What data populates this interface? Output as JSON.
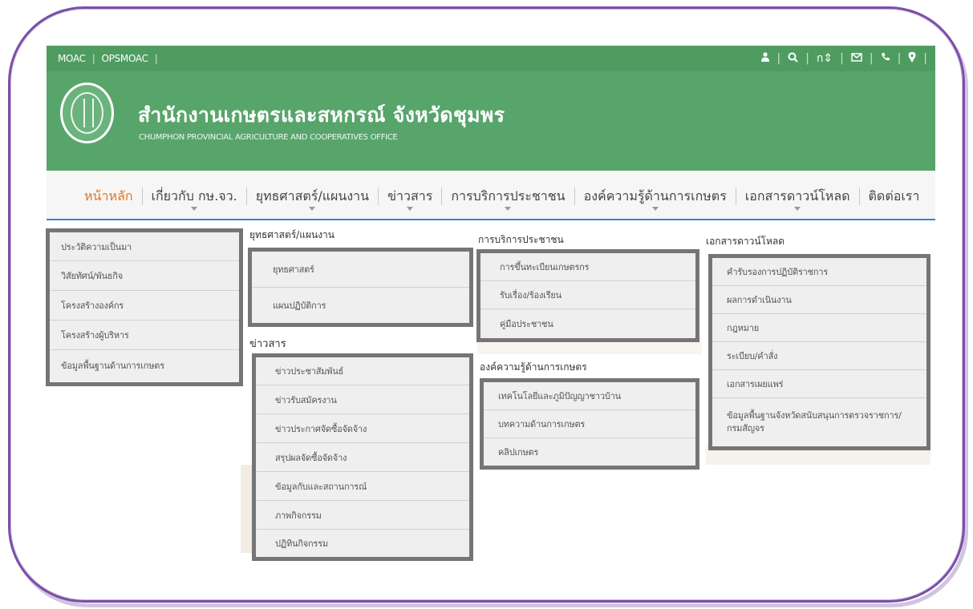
{
  "topbar": {
    "links": [
      "MOAC",
      "OPSMOAC"
    ],
    "icons": [
      "user-icon",
      "search-icon",
      "language-icon",
      "mail-icon",
      "phone-icon",
      "map-pin-icon"
    ],
    "language_label": "ก⇕"
  },
  "header": {
    "title": "สำนักงานเกษตรและสหกรณ์ จังหวัดชุมพร",
    "subtitle": "CHUMPHON PROVINCIAL AGRICULTURE AND COOPERATIVES OFFICE"
  },
  "nav": {
    "items": [
      "หน้าหลัก",
      "เกี่ยวกับ กษ.จว.",
      "ยุทธศาสตร์/แผนงาน",
      "ข่าวสาร",
      "การบริการประชาชน",
      "องค์ความรู้ด้านการเกษตร",
      "เอกสารดาวน์โหลด",
      "ติดต่อเรา"
    ]
  },
  "menus": {
    "about": {
      "items": [
        "ประวัติความเป็นมา",
        "วิสัยทัศน์/พันธกิจ",
        "โครงสร้างองค์กร",
        "โครงสร้างผู้บริหาร",
        "ข้อมูลพื้นฐานด้านการเกษตร"
      ]
    },
    "strategy": {
      "title": "ยุทธศาสตร์/แผนงาน",
      "items": [
        "ยุทธศาสตร์",
        "แผนปฏิบัติการ"
      ]
    },
    "news": {
      "title": "ข่าวสาร",
      "items": [
        "ข่าวประชาสัมพันธ์",
        "ข่าวรับสมัครงาน",
        "ข่าวประกาศจัดซื้อจัดจ้าง",
        "สรุปผลจัดซื้อจัดจ้าง",
        "ข้อมูลกับและสถานการณ์",
        "ภาพกิจกรรม",
        "ปฏิทินกิจกรรม"
      ]
    },
    "service": {
      "title": "การบริการประชาชน",
      "items": [
        "การขึ้นทะเบียนเกษตรกร",
        "รับเรื่อง/ร้องเรียน",
        "คู่มือประชาชน"
      ]
    },
    "knowledge": {
      "title": "องค์ความรู้ด้านการเกษตร",
      "items": [
        "เทคโนโลยีและภูมิปัญญาชาวบ้าน",
        "บทความด้านการเกษตร",
        "คลิปเกษตร"
      ]
    },
    "downloads": {
      "title": "เอกสารดาวน์โหลด",
      "items": [
        "คำรับรองการปฏิบัติราชการ",
        "ผลการดำเนินงาน",
        "กฎหมาย",
        "ระเบียบ/คำสั่ง",
        "เอกสารเผยแพร่",
        "ข้อมูลพื้นฐานจังหวัดสนับสนุนการตรวจราชการ/กรมสัญจร"
      ]
    }
  },
  "colors": {
    "topbar": "#4f9c61",
    "header": "#58a56b",
    "active_nav": "#e8721c",
    "frame": "#7a4fa8",
    "menu_border": "#757575"
  }
}
